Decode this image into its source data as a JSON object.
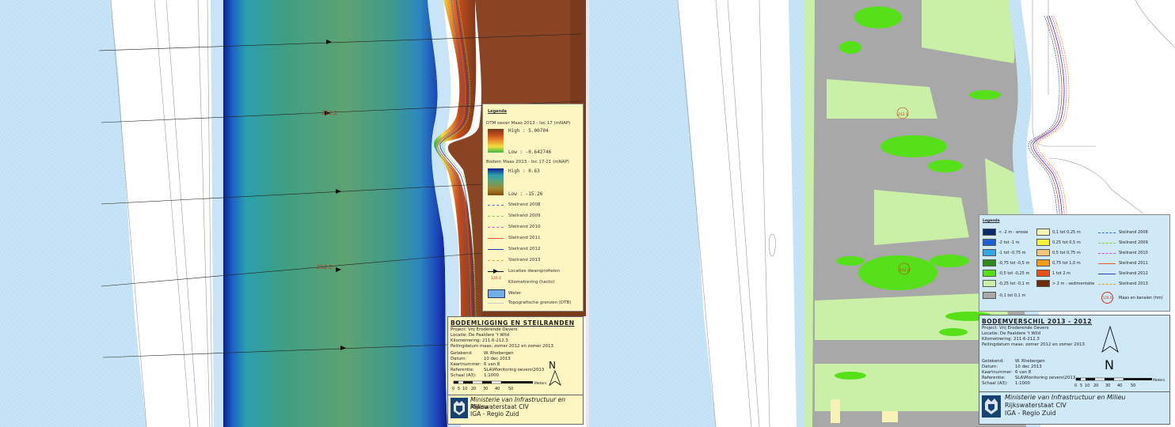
{
  "left_map": {
    "km_labels": [
      "212.1",
      "212.2"
    ],
    "legend": {
      "title": "Legenda",
      "dtm_title": "DTM oever Maas 2013 - loc 17 (mNAP)",
      "dtm_high": "High : 5.00704",
      "dtm_low": "Low : -0.642746",
      "bodem_title": "Bodem Maas 2013 - loc 17-21 (mNAP)",
      "bodem_high": "High : 0.63",
      "bodem_low": "Low : -15.26",
      "steilranden": [
        {
          "label": "Steilrand 2008",
          "color": "#2a6fd6"
        },
        {
          "label": "Steilrand 2009",
          "color": "#7ad23a"
        },
        {
          "label": "Steilrand 2010",
          "color": "#d64bd6"
        },
        {
          "label": "Steilrand 2011",
          "color": "#e8503a"
        },
        {
          "label": "Steilrand 2012",
          "color": "#1f3fae"
        },
        {
          "label": "Steilrand 2013",
          "color": "#e0a020"
        }
      ],
      "locaties": "Locaties dwarsprofielen",
      "km_symbol": "120.4",
      "kilometrering": "Kilometrering (hecto)",
      "water": "Water",
      "topo": "Topografische grenzen (DTB)"
    },
    "title_block": {
      "title": "BODEMLIGGING EN STEILRANDEN",
      "lines": [
        "Project: Vrij Eroderende Oevers",
        "Locatie: De Paaldere 't Wild",
        "Kilometrering:  211.6-212.3",
        "Peilingdatum maas: zomer 2012 en zomer 2013"
      ],
      "fields": [
        {
          "k": "Getekend:",
          "v": "W. Rhebergen"
        },
        {
          "k": "Datum:",
          "v": "10 dec 2013"
        },
        {
          "k": "Kaartnummer:",
          "v": "6 van 8"
        },
        {
          "k": "Referentie:",
          "v": "SLA\\Monitoring oevers\\2013"
        },
        {
          "k": "Schaal (A3):",
          "v": "1:1000"
        }
      ],
      "north": "N",
      "scale_unit": "Meters",
      "scale_ticks": [
        "0",
        "5",
        "10",
        "20",
        "30",
        "40",
        "50"
      ],
      "ministry": "Ministerie van Infrastructuur en Milieu",
      "agency": "Rijkswaterstaat CIV",
      "region": "IGA - Regio Zuid"
    }
  },
  "right_map": {
    "km_labels": [
      "212.1",
      "212.2"
    ],
    "legend": {
      "title": "Legenda",
      "classes_col1": [
        {
          "label": "< -2 m - erosie",
          "color": "#0b2a6b"
        },
        {
          "label": "-2 tot -1 m",
          "color": "#1f5fd0"
        },
        {
          "label": "-1 tot -0,75 m",
          "color": "#35a6e8"
        },
        {
          "label": "-0,75 tot -0,5 m",
          "color": "#2e8a1e"
        },
        {
          "label": "-0,5 tot -0,25 m",
          "color": "#56e01a"
        },
        {
          "label": "-0,25 tot -0,1 m",
          "color": "#c9f0a6"
        },
        {
          "label": "-0,1 tot 0,1 m",
          "color": "#a8a8a8"
        }
      ],
      "classes_col2": [
        {
          "label": "0,1 tot 0,25 m",
          "color": "#f7f2b5"
        },
        {
          "label": "0,25 tot 0,5 m",
          "color": "#f7f23a"
        },
        {
          "label": "0,5 tot 0,75 m",
          "color": "#f7c57a"
        },
        {
          "label": "0,75 tot 1,0 m",
          "color": "#f59a1a"
        },
        {
          "label": "1 tot 2 m",
          "color": "#e8501a"
        },
        {
          "label": "> 2 m - sedimentatie",
          "color": "#6e2a0a"
        }
      ],
      "lines": [
        {
          "label": "Steilrand 2008",
          "color": "#2a6fd6"
        },
        {
          "label": "Steilrand 2009",
          "color": "#7ad23a"
        },
        {
          "label": "Steilrand 2010",
          "color": "#d64bd6"
        },
        {
          "label": "Steilrand 2011",
          "color": "#e8503a"
        },
        {
          "label": "Steilrand 2012",
          "color": "#1f3fae"
        },
        {
          "label": "Steilrand 2013",
          "color": "#e0a020"
        }
      ],
      "km_symbol": "120.4",
      "maas": "Maas en kanalen (hm)"
    },
    "title_block": {
      "title": "BODEMVERSCHIL 2013 - 2012",
      "lines": [
        "Project: Vrij Eroderende Oevers",
        "Locatie: De Paaldere 't Wild",
        "Kilometrering:  211.6-212.3",
        "Peilingdatum maas: zomer 2012 en zomer 2013"
      ],
      "fields": [
        {
          "k": "Getekend:",
          "v": "W. Rhebergen"
        },
        {
          "k": "Datum:",
          "v": "10 dec 2013"
        },
        {
          "k": "Kaartnummer:",
          "v": "6 van 8"
        },
        {
          "k": "Referentie:",
          "v": "SLA\\Monitoring oevers\\2013"
        },
        {
          "k": "Schaal (A3):",
          "v": "1:1000"
        }
      ],
      "north": "N",
      "scale_unit": "Meters",
      "scale_ticks": [
        "0",
        "5",
        "10",
        "20",
        "30",
        "40",
        "50"
      ],
      "ministry": "Ministerie van Infrastructuur en Milieu",
      "agency": "Rijkswaterstaat CIV",
      "region": "IGA - Regio Zuid"
    }
  }
}
